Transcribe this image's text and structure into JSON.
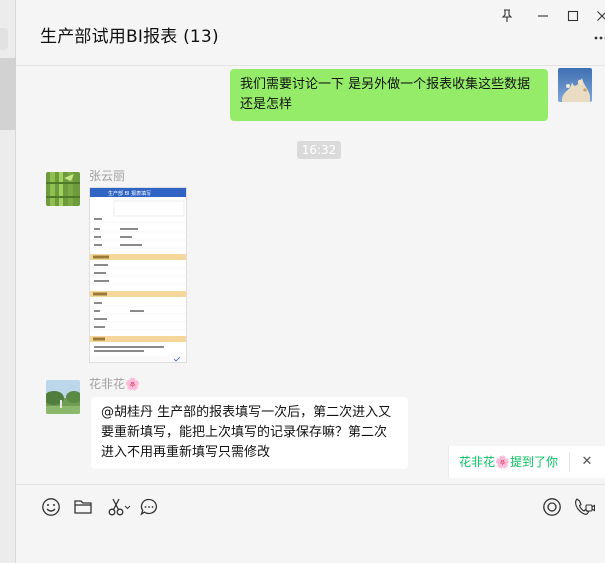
{
  "chat": {
    "title": "生产部试用BI报表 (13)"
  },
  "window": {
    "icons": [
      "pin-icon",
      "minimize-icon",
      "maximize-icon",
      "close-icon",
      "more-icon"
    ]
  },
  "messages": {
    "self_message": {
      "text": "我们需要讨论一下 是另外做一个报表收集这些数据还是怎样"
    },
    "time_divider": "16:32",
    "image_message": {
      "sender": "张云丽",
      "thumb": {
        "title": "生产部 BI 报表填写",
        "sections": [
          "基本信息",
          "生产信息",
          "质量信息",
          "备注"
        ],
        "submit_label": "提交"
      }
    },
    "text_message": {
      "sender": "花非花",
      "sender_emoji": "🌸",
      "text": "@胡桂丹 生产部的报表填写一次后，第二次进入又要重新填写，能把上次填写的记录保存嘛？第二次进入不用再重新填写只需修改"
    }
  },
  "mention_popup": {
    "name": "花非花",
    "emoji": "🌸",
    "suffix": "提到了你",
    "close": "✕"
  },
  "toolbar": {
    "icons": [
      "emoji-icon",
      "folder-icon",
      "scissors-icon",
      "chat-history-icon",
      "live-icon",
      "video-call-icon"
    ]
  },
  "colors": {
    "self_bubble": "#95ec69",
    "other_bubble": "#ffffff",
    "background": "#f5f5f5",
    "mention_green": "#07c160",
    "thumb_section": "#f6d79b"
  }
}
